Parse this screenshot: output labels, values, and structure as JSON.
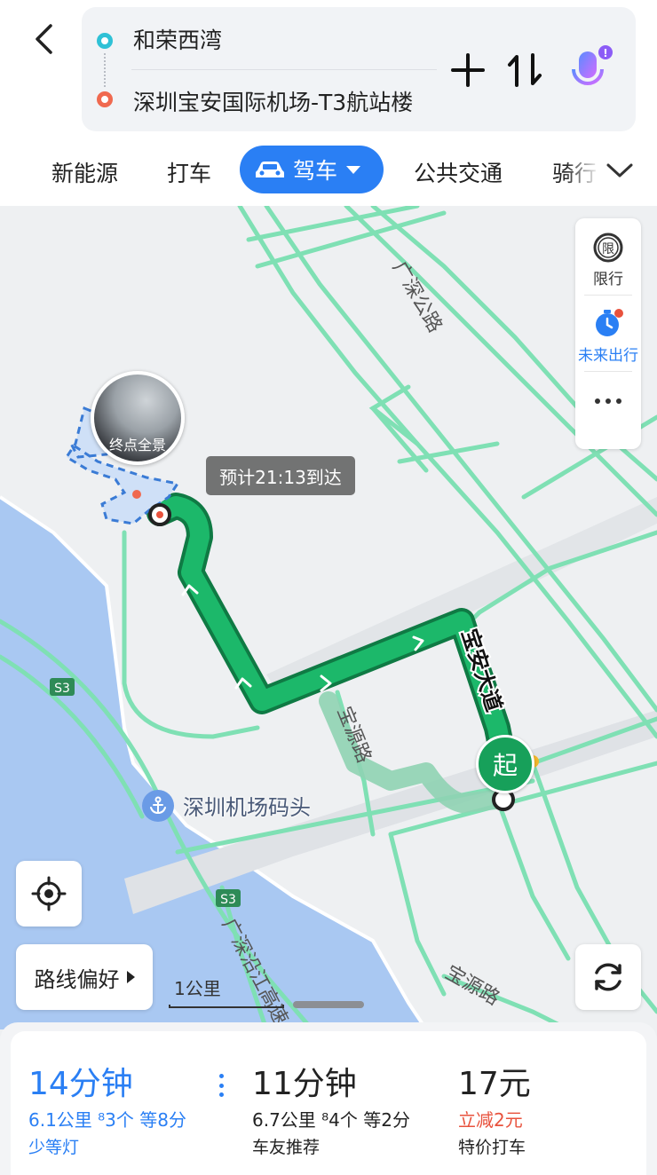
{
  "header": {
    "origin": "和荣西湾",
    "destination": "深圳宝安国际机场-T3航站楼"
  },
  "tabs": {
    "new_energy": "新能源",
    "taxi": "打车",
    "drive": "驾车",
    "transit": "公共交通",
    "ride": "骑行"
  },
  "map": {
    "side_panel": {
      "restriction_badge": "限",
      "restriction": "限行",
      "future_trip": "未来出行"
    },
    "eta": "预计21:13到达",
    "panorama_label": "终点全景",
    "start_badge": "起",
    "place_label": "深圳机场码头",
    "road_labels": {
      "guangshen": "广深公路",
      "baoan_avenue": "宝安大道",
      "baoyuan": "宝源路",
      "baoyuan2": "宝源路",
      "s3a": "S3",
      "s3b": "S3",
      "yanjiang": "广深沿江高速"
    },
    "route_pref": "路线偏好",
    "scale": "1公里"
  },
  "plans": [
    {
      "time": "14分钟",
      "detail": "6.1公里  ⁸3个  等8分",
      "tag": "少等灯",
      "color": "#2a7ff4"
    },
    {
      "time": "11分钟",
      "detail": "6.7公里  ⁸4个  等2分",
      "tag": "车友推荐",
      "color": "#222222"
    },
    {
      "time": "17元",
      "detail": "立减2元",
      "tag": "特价打车",
      "color": "#222222",
      "detail_color": "#e8523d"
    }
  ],
  "colors": {
    "accent": "#2a7ff4",
    "route_green": "#17a05a",
    "water": "#a9c8f2",
    "road": "#7fe0b4"
  }
}
